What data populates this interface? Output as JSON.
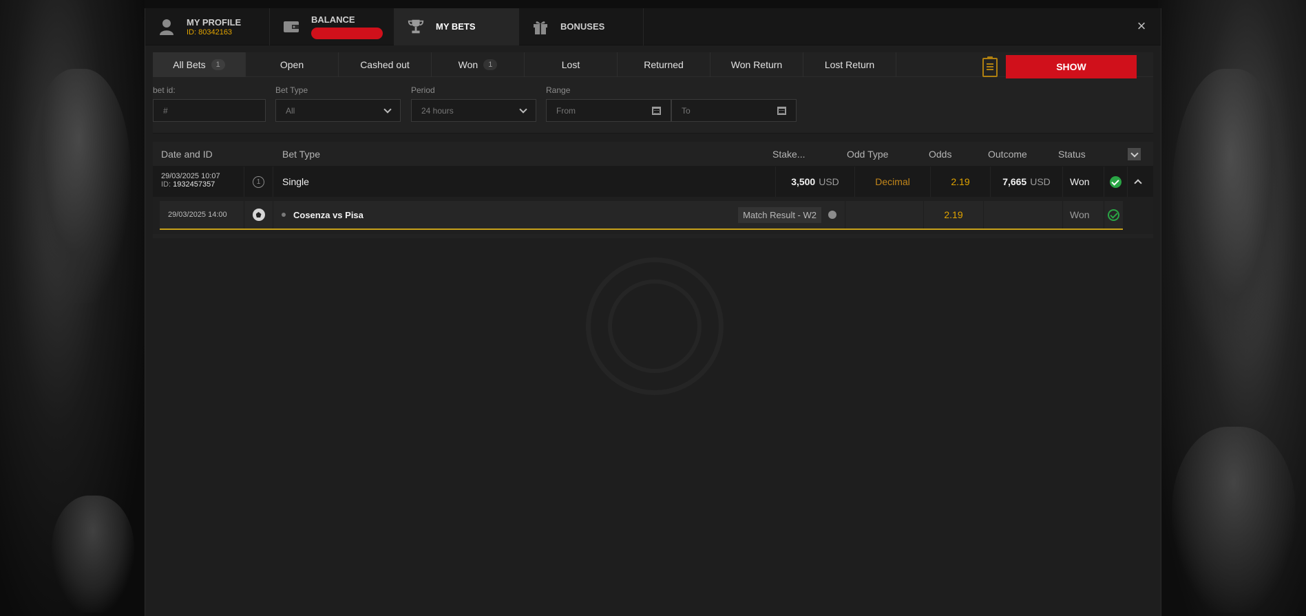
{
  "header": {
    "tabs": [
      {
        "label": "MY PROFILE",
        "sub": "ID: 80342163",
        "icon": "user-icon"
      },
      {
        "label": "BALANCE",
        "sub": "",
        "icon": "wallet-icon"
      },
      {
        "label": "MY BETS",
        "sub": "",
        "icon": "trophy-icon"
      },
      {
        "label": "BONUSES",
        "sub": "",
        "icon": "gift-icon"
      }
    ],
    "close": "×"
  },
  "filter_tabs": [
    {
      "label": "All Bets",
      "count": "1"
    },
    {
      "label": "Open",
      "count": ""
    },
    {
      "label": "Cashed out",
      "count": ""
    },
    {
      "label": "Won",
      "count": "1"
    },
    {
      "label": "Lost",
      "count": ""
    },
    {
      "label": "Returned",
      "count": ""
    },
    {
      "label": "Won Return",
      "count": ""
    },
    {
      "label": "Lost Return",
      "count": ""
    }
  ],
  "filters": {
    "bet_id": {
      "label": "bet id:",
      "placeholder": "#"
    },
    "bet_type": {
      "label": "Bet Type",
      "value": "All"
    },
    "period": {
      "label": "Period",
      "value": "24 hours"
    },
    "range": {
      "label": "Range",
      "from": "From",
      "to": "To"
    },
    "show_label": "SHOW"
  },
  "table": {
    "columns": {
      "date_id": "Date and ID",
      "bet_type": "Bet Type",
      "stake": "Stake...",
      "odd_type": "Odd Type",
      "odds": "Odds",
      "outcome": "Outcome",
      "status": "Status"
    },
    "bet": {
      "date": "29/03/2025 10:07",
      "id_label": "ID:",
      "id": "1932457357",
      "selections": "1",
      "type": "Single",
      "stake": "3,500",
      "currency": "USD",
      "odd_type": "Decimal",
      "odds": "2.19",
      "outcome": "7,665",
      "outcome_currency": "USD",
      "status": "Won"
    },
    "selection": {
      "date": "29/03/2025 14:00",
      "event": "Cosenza vs Pisa",
      "market": "Match Result - W2",
      "odds": "2.19",
      "status": "Won"
    }
  },
  "colors": {
    "accent_red": "#d0101b",
    "gold": "#e2a400",
    "won_green": "#2aa545"
  }
}
